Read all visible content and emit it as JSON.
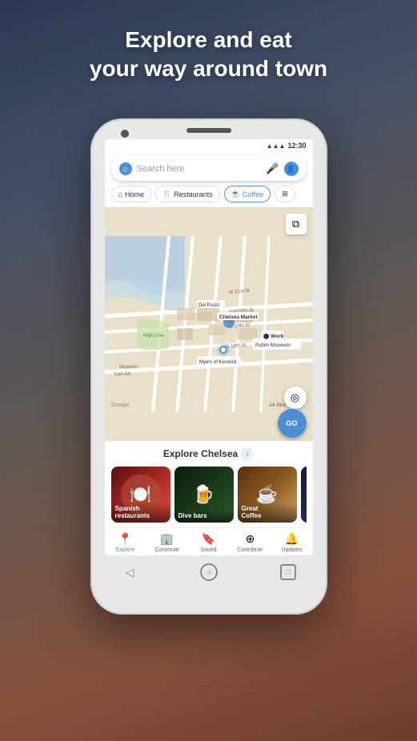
{
  "background": {
    "headline_line1": "Explore and eat",
    "headline_line2": "your way around town"
  },
  "phone": {
    "status_bar": {
      "time": "12:30",
      "signal": "▲▲▲",
      "wifi": "◆◆",
      "battery": "▐"
    },
    "search": {
      "placeholder": "Search here",
      "mic_label": "microphone",
      "avatar_label": "account"
    },
    "chips": [
      {
        "id": "home",
        "icon": "⌂",
        "label": "Home"
      },
      {
        "id": "restaurants",
        "icon": "🍴",
        "label": "Restaurants"
      },
      {
        "id": "coffee",
        "icon": "☕",
        "label": "Coffee"
      },
      {
        "id": "more",
        "icon": "⊞",
        "label": "More"
      }
    ],
    "map": {
      "go_button": "GO",
      "labels": [
        {
          "id": "work",
          "text": "Work"
        },
        {
          "id": "chelsea_market",
          "text": "Chelsea Market"
        },
        {
          "id": "myers",
          "text": "Myers of Keswick"
        },
        {
          "id": "museum",
          "text": "Museum"
        },
        {
          "id": "14th",
          "text": "14 Stre"
        },
        {
          "id": "del_posto",
          "text": "Del Posto"
        }
      ],
      "google_logo": "Google"
    },
    "explore": {
      "title": "Explore Chelsea",
      "chevron": "›",
      "cards": [
        {
          "id": "spanish",
          "label_line1": "Spanish",
          "label_line2": "restaurants",
          "emoji": "🍽️",
          "theme": "spanish"
        },
        {
          "id": "dive",
          "label_line1": "Dive bars",
          "label_line2": "",
          "emoji": "🍺",
          "theme": "dive"
        },
        {
          "id": "coffee",
          "label_line1": "Great",
          "label_line2": "Coffee",
          "emoji": "☕",
          "theme": "coffee"
        },
        {
          "id": "extra",
          "label_line1": "",
          "label_line2": "",
          "emoji": "",
          "theme": "extra"
        }
      ]
    },
    "bottom_nav": [
      {
        "id": "explore",
        "icon": "📍",
        "label": "Explore",
        "active": true
      },
      {
        "id": "commute",
        "icon": "🏢",
        "label": "Commute",
        "active": false
      },
      {
        "id": "saved",
        "icon": "🔖",
        "label": "Saved",
        "active": false
      },
      {
        "id": "contribute",
        "icon": "⊕",
        "label": "Contribute",
        "active": false
      },
      {
        "id": "updates",
        "icon": "🔔",
        "label": "Updates",
        "active": false
      }
    ],
    "nav_buttons": {
      "back": "◁",
      "home": "○",
      "recents": "□"
    }
  }
}
